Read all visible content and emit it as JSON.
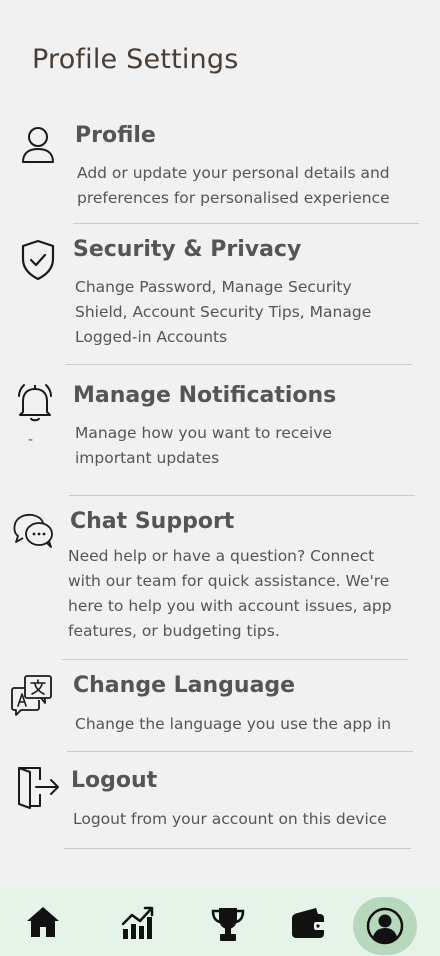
{
  "page": {
    "title": "Profile Settings"
  },
  "items": [
    {
      "icon": "user-icon",
      "title": "Profile",
      "description": "Add or update your personal details and preferences for personalised experience"
    },
    {
      "icon": "shield-check-icon",
      "title": "Security & Privacy",
      "description": "Change Password, Manage Security Shield, Account Security Tips, Manage Logged-in Accounts"
    },
    {
      "icon": "bell-icon",
      "title": "Manage Notifications",
      "description": "Manage how you want to receive important updates",
      "marker": "-"
    },
    {
      "icon": "chat-bubbles-icon",
      "title": "Chat Support",
      "description": "Need help or have a question? Connect with our team for quick assistance. We're here to help you with account issues, app features, or budgeting tips."
    },
    {
      "icon": "translate-icon",
      "title": "Change Language",
      "description": "Change the language you use the app in"
    },
    {
      "icon": "logout-icon",
      "title": "Logout",
      "description": "Logout from your account on this device"
    }
  ],
  "bottom_nav": {
    "items": [
      "home-icon",
      "analytics-icon",
      "trophy-icon",
      "wallet-icon",
      "profile-icon"
    ],
    "active": "profile-icon",
    "active_color": "#b7d8bd",
    "background": "#e6f3e8"
  }
}
